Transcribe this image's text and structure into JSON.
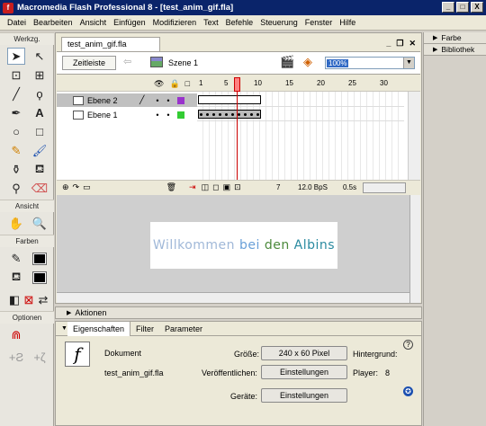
{
  "window": {
    "title": "Macromedia Flash Professional 8 - [test_anim_gif.fla]",
    "controls": [
      "_",
      "□",
      "X"
    ]
  },
  "menu": [
    "Datei",
    "Bearbeiten",
    "Ansicht",
    "Einfügen",
    "Modifizieren",
    "Text",
    "Befehle",
    "Steuerung",
    "Fenster",
    "Hilfe"
  ],
  "toolbox": {
    "werkzeug_label": "Werkzg.",
    "ansicht_label": "Ansicht",
    "farben_label": "Farben",
    "optionen_label": "Optionen"
  },
  "right_panels": {
    "farbe": "Farbe",
    "bibliothek": "Bibliothek"
  },
  "document": {
    "tab": "test_anim_gif.fla",
    "timeline_button": "Zeitleiste",
    "scene": "Szene 1",
    "zoom": "100%"
  },
  "timeline": {
    "frame_numbers": [
      "1",
      "5",
      "10",
      "15",
      "20",
      "25",
      "30"
    ],
    "layers": [
      {
        "name": "Ebene 2",
        "color": "#9933cc",
        "selected": true
      },
      {
        "name": "Ebene 1",
        "color": "#33cc33",
        "selected": false
      }
    ],
    "current_frame": "7",
    "fps": "12.0 BpS",
    "time": "0.5s"
  },
  "stage": {
    "text_parts": [
      "Willkommen",
      " bei",
      " den",
      " Albins"
    ]
  },
  "panels": {
    "aktionen": "Aktionen",
    "tabs": [
      "Eigenschaften",
      "Filter",
      "Parameter"
    ]
  },
  "properties": {
    "type": "Dokument",
    "filename": "test_anim_gif.fla",
    "size_label": "Größe:",
    "size_value": "240 x 60 Pixel",
    "bg_label": "Hintergrund:",
    "publish_label": "Veröffentlichen:",
    "publish_button": "Einstellungen",
    "player_label": "Player:",
    "player_value": "8",
    "devices_label": "Geräte:",
    "devices_button": "Einstellungen"
  },
  "colors": {
    "accent": "#0a246a",
    "playhead": "#cc0000"
  }
}
